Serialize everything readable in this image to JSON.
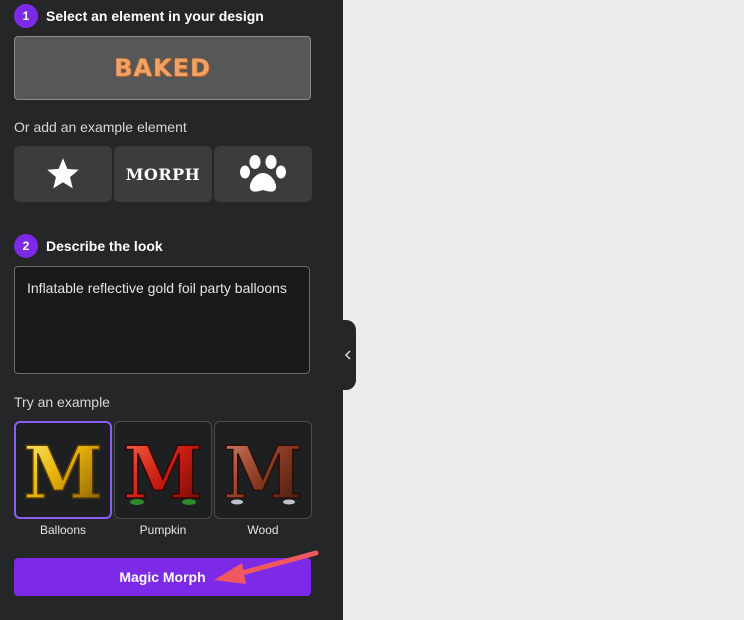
{
  "step1": {
    "number": "1",
    "title": "Select an element in your design"
  },
  "selected_element": {
    "text": "BAKED"
  },
  "example_prompt": "Or add an example element",
  "example_elements": [
    {
      "icon": "star-icon"
    },
    {
      "label": "MORPH"
    },
    {
      "icon": "paw-icon"
    }
  ],
  "step2": {
    "number": "2",
    "title": "Describe the look"
  },
  "description": {
    "value": "Inflatable reflective gold foil party balloons"
  },
  "try_example": "Try an example",
  "styles": [
    {
      "label": "Balloons",
      "selected": true
    },
    {
      "label": "Pumpkin",
      "selected": false
    },
    {
      "label": "Wood",
      "selected": false
    }
  ],
  "magic_button": {
    "label": "Magic Morph"
  },
  "colors": {
    "accent": "#7d2ae8",
    "panel": "#252627",
    "annotation_arrow": "#f0575e"
  }
}
